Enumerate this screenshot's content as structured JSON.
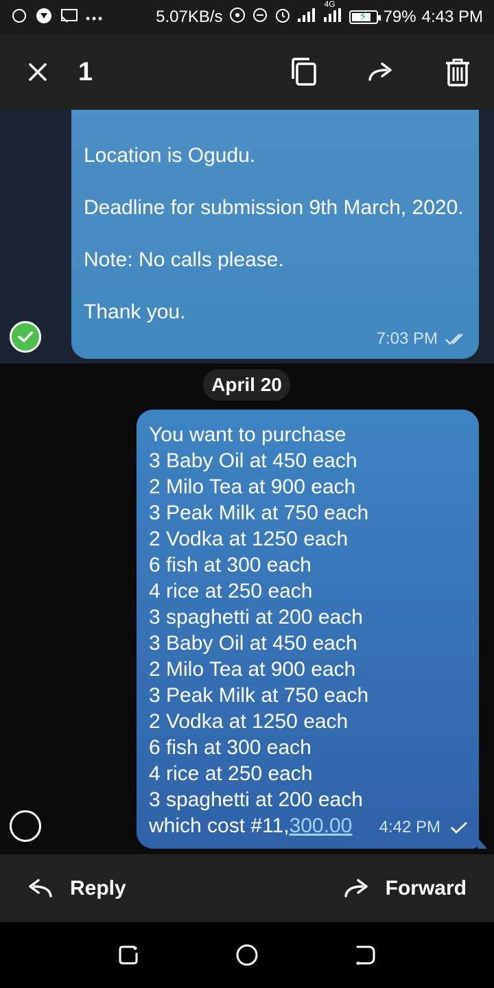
{
  "status_bar": {
    "speed": "5.07KB/s",
    "network": "4G",
    "battery_percent": "79%",
    "battery_level": 0.79,
    "time": "4:43 PM",
    "icons": [
      "messenger-icon",
      "app-icon",
      "cast-icon",
      "more-dots-icon",
      "hotspot-icon",
      "dnd-icon",
      "alarm-icon",
      "signal-icon",
      "signal-4g-icon",
      "battery-charging-icon"
    ]
  },
  "action_bar": {
    "selected_count": "1",
    "icons": [
      "close-icon",
      "copy-icon",
      "forward-icon",
      "delete-icon"
    ]
  },
  "messages": [
    {
      "paragraphs": [
        "Location is Ogudu.",
        "Deadline for submission 9th March, 2020.",
        "Note: No calls please.",
        "Thank you."
      ],
      "time": "7:03 PM",
      "status": "read",
      "selected": true
    },
    {
      "date_separator": "April 20",
      "lines": [
        "You want to purchase",
        "3 Baby Oil at 450 each",
        "2 Milo Tea at 900 each",
        "3 Peak Milk at 750 each",
        "2 Vodka at 1250 each",
        "6 fish at 300 each",
        "4 rice at 250 each",
        "3 spaghetti at 200 each",
        "3 Baby Oil at 450 each",
        "2 Milo Tea at 900 each",
        "3 Peak Milk at 750 each",
        "2 Vodka at 1250 each",
        "6 fish at 300 each",
        "4 rice at 250 each",
        "3 spaghetti at 200 each"
      ],
      "last_line_prefix": "which cost #11,",
      "last_line_link": "300.00",
      "time": "4:42 PM",
      "status": "sent",
      "selected": false
    }
  ],
  "bottom_bar": {
    "reply_label": "Reply",
    "forward_label": "Forward"
  },
  "nav_bar": {
    "icons": [
      "recent-apps-icon",
      "home-icon",
      "back-icon"
    ]
  },
  "colors": {
    "accent_check": "#4cc04c",
    "bubble": "#3f84c2",
    "link": "#9fd0ff"
  }
}
